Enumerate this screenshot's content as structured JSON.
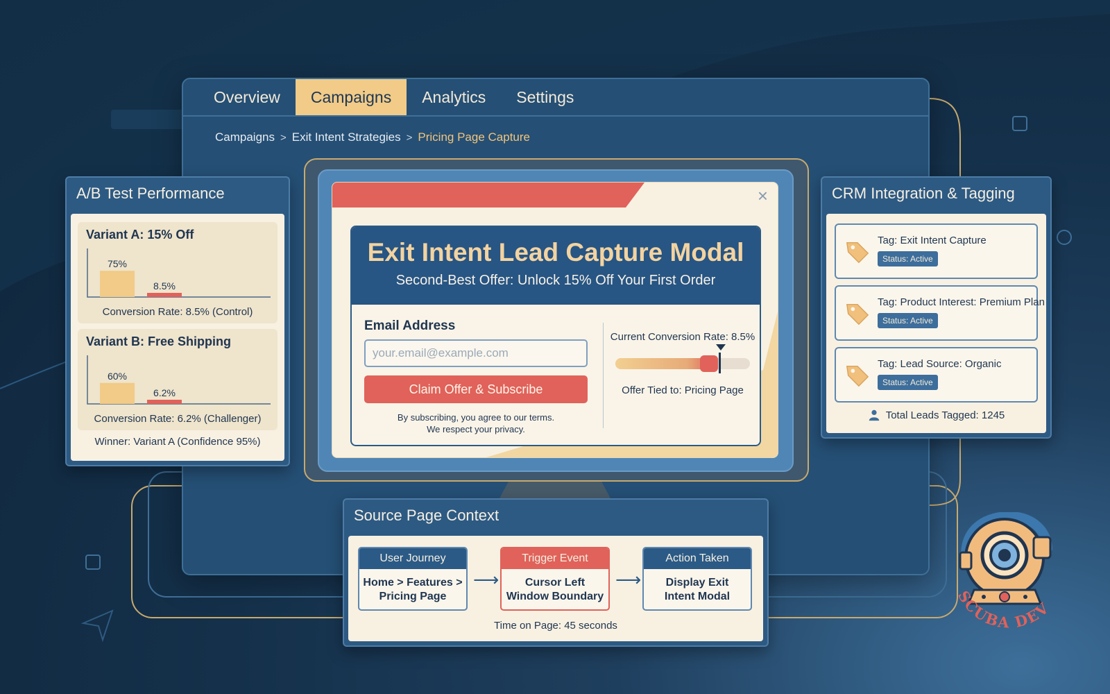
{
  "tabs": [
    {
      "label": "Overview",
      "active": false
    },
    {
      "label": "Campaigns",
      "active": true
    },
    {
      "label": "Analytics",
      "active": false
    },
    {
      "label": "Settings",
      "active": false
    }
  ],
  "breadcrumb": {
    "items": [
      "Campaigns",
      "Exit Intent Strategies"
    ],
    "current": "Pricing Page Capture",
    "separator": ">"
  },
  "ab_panel": {
    "title": "A/B Test Performance",
    "variants": [
      {
        "name": "Variant A: 15% Off",
        "bar1_label": "75%",
        "bar1_value": 75,
        "bar2_label": "8.5%",
        "bar2_value": 8.5,
        "rate_text": "Conversion Rate: 8.5% (Control)"
      },
      {
        "name": "Variant B: Free Shipping",
        "bar1_label": "60%",
        "bar1_value": 60,
        "bar2_label": "6.2%",
        "bar2_value": 6.2,
        "rate_text": "Conversion Rate: 6.2% (Challenger)"
      }
    ],
    "winner_text": "Winner: Variant A (Confidence 95%)"
  },
  "modal": {
    "close_icon": "×",
    "title": "Exit Intent Lead Capture Modal",
    "subtitle": "Second-Best Offer: Unlock 15% Off Your First Order",
    "email_label": "Email Address",
    "email_value": "",
    "email_placeholder": "your.email@example.com",
    "button_label": "Claim Offer & Subscribe",
    "terms_line1": "By subscribing, you agree to our terms.",
    "terms_line2": "We respect your privacy.",
    "conversion_label": "Current Conversion Rate: 8.5%",
    "slider_value": 0.76,
    "offer_tied": "Offer Tied to: Pricing Page"
  },
  "crm_panel": {
    "title": "CRM Integration & Tagging",
    "tags": [
      {
        "name": "Tag: Exit Intent Capture",
        "status": "Status: Active"
      },
      {
        "name": "Tag: Product Interest: Premium Plan",
        "status": "Status: Active"
      },
      {
        "name": "Tag: Lead Source: Organic",
        "status": "Status: Active"
      }
    ],
    "total_leads": "Total Leads Tagged: 1245"
  },
  "source_panel": {
    "title": "Source Page Context",
    "steps": [
      {
        "head": "User Journey",
        "line1": "Home > Features >",
        "line2": "Pricing Page"
      },
      {
        "head": "Trigger Event",
        "line1": "Cursor Left",
        "line2": "Window Boundary"
      },
      {
        "head": "Action Taken",
        "line1": "Display Exit",
        "line2": "Intent Modal"
      }
    ],
    "arrow": "⟶",
    "time_on_page": "Time on Page: 45 seconds"
  },
  "logo": {
    "text": "SCUBA DEV"
  },
  "colors": {
    "background": "#14304a",
    "panel": "#2d5a83",
    "cream": "#f8f1e2",
    "accent_gold": "#f1cb87",
    "accent_red": "#e0625a",
    "navy": "#275584"
  },
  "icons": {
    "tag": "tag-icon",
    "user": "user-icon",
    "close": "close-icon",
    "arrow": "arrow-right-icon",
    "logo": "diving-helmet-icon"
  }
}
